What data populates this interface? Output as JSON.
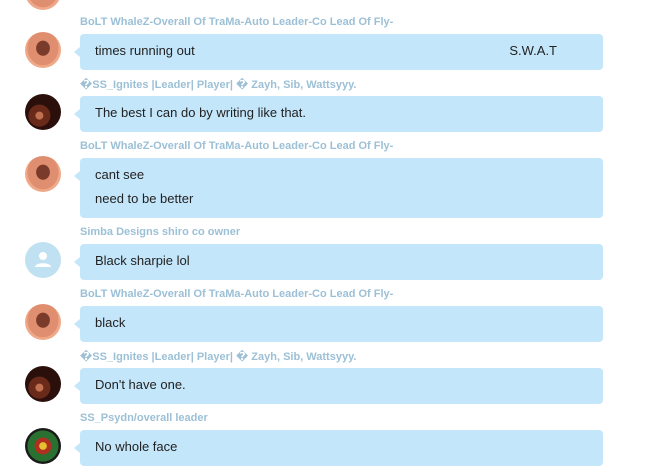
{
  "messages": [
    {
      "sender": "BoLT WhaleZ-Overall Of TraMa-Auto Leader-Co Lead Of Fly-",
      "lines": [
        "times running out"
      ],
      "extra": "S.W.A.T",
      "avatar": "whale-avatar"
    },
    {
      "sender": "�SS_Ignites |Leader| Player| � Zayh, Sib, Wattsyyy.",
      "lines": [
        "The best I can do by writing like that."
      ],
      "avatar": "ss-ignites-avatar"
    },
    {
      "sender": "BoLT WhaleZ-Overall Of TraMa-Auto Leader-Co Lead Of Fly-",
      "lines": [
        "cant see",
        "need to be better"
      ],
      "avatar": "whale-avatar"
    },
    {
      "sender": "Simba Designs shiro co owner",
      "lines": [
        "Black sharpie lol"
      ],
      "avatar": "default-user-icon"
    },
    {
      "sender": "BoLT WhaleZ-Overall Of TraMa-Auto Leader-Co Lead Of Fly-",
      "lines": [
        "black"
      ],
      "avatar": "whale-avatar"
    },
    {
      "sender": "�SS_Ignites |Leader| Player| � Zayh, Sib, Wattsyyy.",
      "lines": [
        "Don't have one."
      ],
      "avatar": "ss-ignites-avatar"
    },
    {
      "sender": "SS_Psydn/overall leader",
      "lines": [
        "No whole face"
      ],
      "avatar": "psydn-avatar"
    }
  ]
}
